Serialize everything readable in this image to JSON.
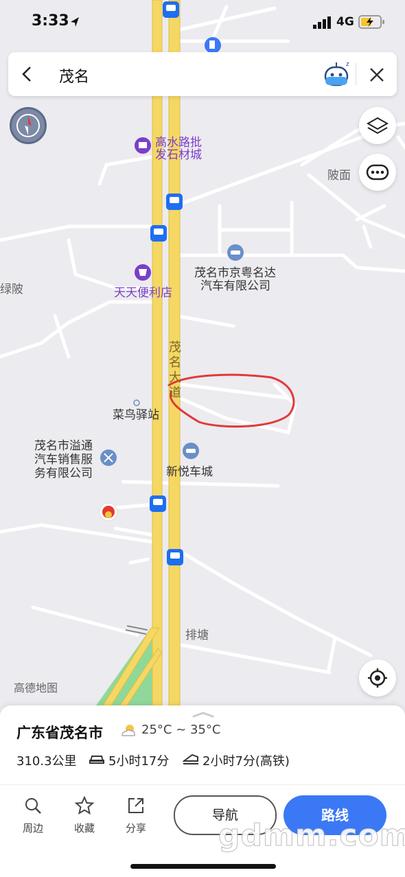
{
  "status_bar": {
    "time": "3:33",
    "network": "4G"
  },
  "search": {
    "query": "茂名"
  },
  "map": {
    "labels": {
      "gaoshui": "高水路批",
      "gaoshui2": "发石材城",
      "shenmian": "陂面",
      "jingyue": "茂名市京粤名达",
      "jingyue2": "汽车有限公司",
      "tiantian": "天天便利店",
      "lvpo": "绿陂",
      "road": "茂名大道",
      "cainiao": "菜鸟驿站",
      "yitong1": "茂名市溢通",
      "yitong2": "汽车销售服",
      "yitong3": "务有限公司",
      "xinyue": "新悦车城",
      "paitang": "排塘",
      "brand": "高德地图"
    }
  },
  "panel": {
    "city": "广东省茂名市",
    "temperature": "25°C ~ 35°C",
    "distance": "310.3公里",
    "drive_time": "5小时17分",
    "train_time": "2小时7分(高铁)"
  },
  "toolbar": {
    "nearby": "周边",
    "favorite": "收藏",
    "share": "分享",
    "navigate": "导航",
    "route": "路线"
  },
  "watermark": "gdmm.com",
  "colors": {
    "road": "#f5d764",
    "accent": "#3b78f6",
    "bus": "#1f6ef0",
    "annotation": "#e03a3a"
  }
}
